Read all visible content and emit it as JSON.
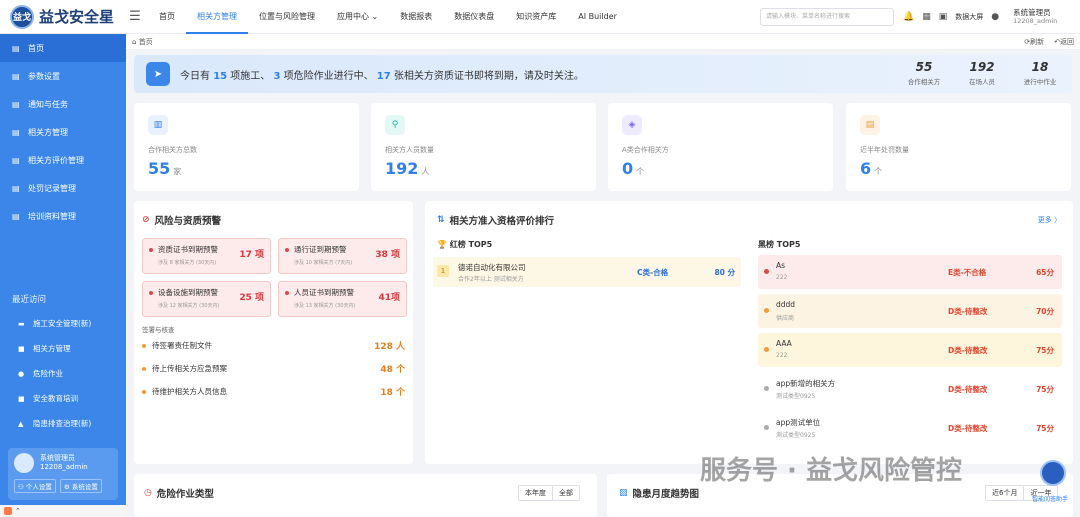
{
  "app": {
    "title": "益戈安全星",
    "logo_badge": "益戈"
  },
  "nav": {
    "items": [
      "首页",
      "相关方管理",
      "位置与风险管理",
      "应用中心",
      "数据报表",
      "数据仪表盘",
      "知识资产库",
      "AI Builder"
    ],
    "active_index": 1
  },
  "search": {
    "placeholder": "请输入模块、菜单名称进行搜索"
  },
  "header": {
    "dashboard_label": "数据大屏",
    "user_name": "系统管理员",
    "user_id": "12208_admin"
  },
  "sidebar": {
    "items": [
      "首页",
      "参数设置",
      "通知与任务",
      "相关方管理",
      "相关方评价管理",
      "处罚记录管理",
      "培训资料管理"
    ],
    "recent_title": "最近访问",
    "recent": [
      "施工安全管理(新)",
      "相关方管理",
      "危险作业",
      "安全教育培训",
      "隐患排查治理(新)"
    ],
    "user_name": "系统管理员",
    "user_id": "12208_admin",
    "btn_personal": "个人设置",
    "btn_system": "系统设置"
  },
  "breadcrumb": {
    "home": "首页",
    "refresh": "刷新",
    "back": "返回"
  },
  "banner": {
    "p1": "今日有 ",
    "n1": "15",
    "p2": " 项施工、 ",
    "n2": "3",
    "p3": " 项危险作业进行中、 ",
    "n3": "17",
    "p4": " 张相关方资质证书即将到期，请及时关注。",
    "stats": [
      {
        "value": "55",
        "label": "合作相关方"
      },
      {
        "value": "192",
        "label": "在场人员"
      },
      {
        "value": "18",
        "label": "进行中作业"
      }
    ]
  },
  "kpis": [
    {
      "label": "合作相关方总数",
      "value": "55",
      "unit": "家",
      "color": "#2f80ed",
      "bg": "#e8f1fd",
      "icon": "building-icon"
    },
    {
      "label": "相关方人员数量",
      "value": "192",
      "unit": "人",
      "color": "#1fb5a5",
      "bg": "#e3f7f4",
      "icon": "person-icon"
    },
    {
      "label": "A类合作相关方",
      "value": "0",
      "unit": "个",
      "color": "#7b61ff",
      "bg": "#efebff",
      "icon": "medal-icon"
    },
    {
      "label": "近半年处罚数量",
      "value": "6",
      "unit": "个",
      "color": "#f39c39",
      "bg": "#fdf2e3",
      "icon": "document-icon"
    }
  ],
  "risk": {
    "title": "风险与资质预警",
    "cards": [
      {
        "name": "资质证书到期预警",
        "sub": "涉及 8 家相关方 (30天内)",
        "value": "17 项"
      },
      {
        "name": "通行证到期预警",
        "sub": "涉及 10 家相关方 (7天内)",
        "value": "38 项"
      },
      {
        "name": "设备设施到期预警",
        "sub": "涉及 12 家相关方 (30天内)",
        "value": "25 项"
      },
      {
        "name": "人员证书到期预警",
        "sub": "涉及 13 家相关方 (30天内)",
        "value": "41项"
      }
    ],
    "sign_title": "签署与核查",
    "signs": [
      {
        "name": "待签署责任制文件",
        "value": "128 人"
      },
      {
        "name": "待上传相关方应急预案",
        "value": "48 个"
      },
      {
        "name": "待维护相关方人员信息",
        "value": "18 个"
      }
    ]
  },
  "rank": {
    "title": "相关方准入资格评价排行",
    "more": "更多 〉",
    "red_title": "红榜 TOP5",
    "black_title": "黑榜 TOP5",
    "red": [
      {
        "rank": "1",
        "name": "德诺自动化有限公司",
        "sub": "合作2年以上 测试相关方",
        "grade": "C类-合格",
        "score": "80 分"
      }
    ],
    "black": [
      {
        "name": "As",
        "sub": "222",
        "grade": "E类-不合格",
        "score": "65分",
        "bg": "#fdeaea",
        "dot": "#e04848"
      },
      {
        "name": "dddd",
        "sub": "供应商",
        "grade": "D类-待整改",
        "score": "70分",
        "bg": "#fdf3e3",
        "dot": "#f39c39"
      },
      {
        "name": "AAA",
        "sub": "222",
        "grade": "D类-待整改",
        "score": "75分",
        "bg": "#fdf6dc",
        "dot": "#f39c39"
      },
      {
        "name": "app新增的相关方",
        "sub": "测试类型0925",
        "grade": "D类-待整改",
        "score": "75分",
        "bg": "#ffffff",
        "dot": "#aaaaaa"
      },
      {
        "name": "app测试单位",
        "sub": "测试类型0925",
        "grade": "D类-待整改",
        "score": "75分",
        "bg": "#ffffff",
        "dot": "#aaaaaa"
      }
    ]
  },
  "bottom": {
    "left_title": "危险作业类型",
    "left_seg": [
      "本年度",
      "全部"
    ],
    "right_title": "隐患月度趋势图",
    "right_seg": [
      "近6个月",
      "近一年"
    ]
  },
  "watermark": "服务号 · 益戈风险管控",
  "assistant_label": "智能问答助手"
}
